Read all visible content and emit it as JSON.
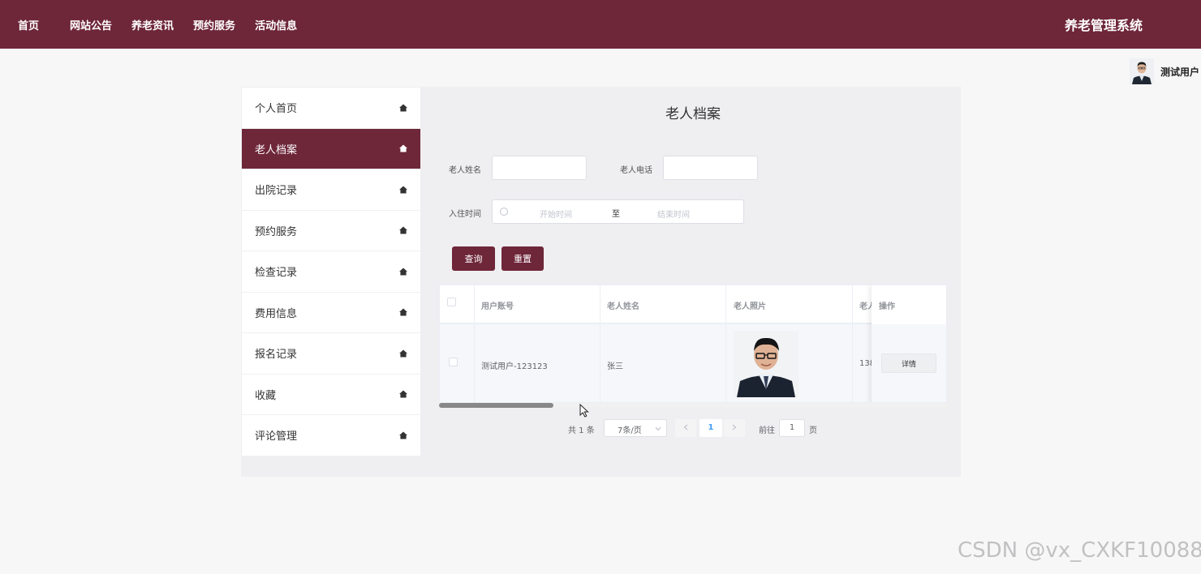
{
  "nav": {
    "items": [
      "首页",
      "网站公告",
      "养老资讯",
      "预约服务",
      "活动信息"
    ],
    "brand": "养老管理系统"
  },
  "user": {
    "name": "测试用户"
  },
  "sidebar": {
    "items": [
      {
        "label": "个人首页",
        "active": false
      },
      {
        "label": "老人档案",
        "active": true
      },
      {
        "label": "出院记录",
        "active": false
      },
      {
        "label": "预约服务",
        "active": false
      },
      {
        "label": "检查记录",
        "active": false
      },
      {
        "label": "费用信息",
        "active": false
      },
      {
        "label": "报名记录",
        "active": false
      },
      {
        "label": "收藏",
        "active": false
      },
      {
        "label": "评论管理",
        "active": false
      }
    ]
  },
  "main": {
    "title": "老人档案",
    "filters": {
      "name_label": "老人姓名",
      "phone_label": "老人电话",
      "checkin_label": "入住时间",
      "start_placeholder": "开始时间",
      "range_separator": "至",
      "end_placeholder": "结束时间"
    },
    "buttons": {
      "search": "查询",
      "reset": "重置"
    },
    "table": {
      "headers": [
        "用户账号",
        "老人姓名",
        "老人照片",
        "老人",
        "操作"
      ],
      "rows": [
        {
          "account": "测试用户-123123",
          "name": "张三",
          "phone": "138",
          "action": "详情"
        }
      ]
    },
    "pagination": {
      "total": "共 1 条",
      "page_size": "7条/页",
      "current_page": "1",
      "goto_label": "前往",
      "goto_value": "1",
      "page_suffix": "页"
    }
  },
  "watermark": "CSDN @vx_CXKF10088",
  "colors": {
    "brand": "#6e2639",
    "page_bg": "#f7f7f8",
    "panel_bg": "#efeef0",
    "link": "#409eff"
  }
}
